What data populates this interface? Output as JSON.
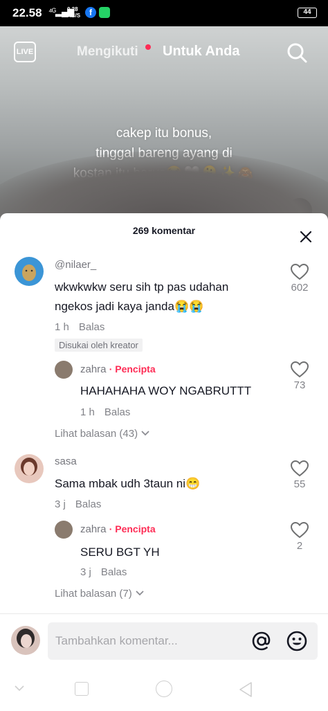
{
  "status_bar": {
    "time": "22.58",
    "signal": "⁴ᴳ▂▄▆",
    "speed_value": "0.28",
    "speed_unit": "KB/S",
    "facebook_letter": "f",
    "battery": "44"
  },
  "header": {
    "live_label": "LIVE",
    "tab_following": "Mengikuti",
    "tab_for_you": "Untuk Anda"
  },
  "video": {
    "caption_lines": [
      "cakep itu bonus,",
      "tinggal bareng ayang di",
      "kostan itu harus"
    ],
    "caption_emojis": "😭🤍🫠✨🙈"
  },
  "comments_sheet": {
    "title": "269 komentar",
    "comments": [
      {
        "username": "@nilaer_",
        "text_line1": "wkwkwkw seru sih tp pas udahan",
        "text_line2": "ngekos jadi kaya janda😭😭",
        "time": "1 h",
        "reply_label": "Balas",
        "liked_badge": "Disukai oleh kreator",
        "likes": "602",
        "reply": {
          "username": "zahra",
          "creator_tag": "· Pencipta",
          "text": "HAHAHAHA WOY NGABRUTTT",
          "time": "1 h",
          "reply_label": "Balas",
          "likes": "73"
        },
        "view_replies": "Lihat balasan (43)"
      },
      {
        "username": "sasa",
        "text": "Sama mbak udh 3taun ni😁",
        "time": "3 j",
        "reply_label": "Balas",
        "likes": "55",
        "reply": {
          "username": "zahra",
          "creator_tag": "· Pencipta",
          "text": "SERU BGT YH",
          "time": "3 j",
          "reply_label": "Balas",
          "likes": "2"
        },
        "view_replies": "Lihat balasan (7)"
      }
    ]
  },
  "input": {
    "placeholder": "Tambahkan komentar..."
  },
  "colors": {
    "accent": "#fe2c55",
    "text_primary": "#161823",
    "input_bg": "#f1f1f2"
  }
}
